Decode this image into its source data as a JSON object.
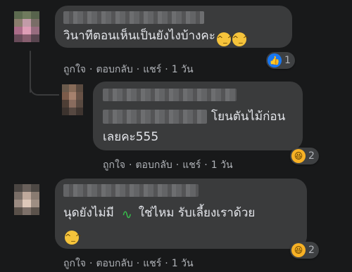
{
  "comments": [
    {
      "text": "วินาทีตอนเห็นเป็นยังไงบ้างคะ",
      "emojis": [
        "😅",
        "😅"
      ],
      "actions": {
        "like": "ถูกใจ",
        "reply": "ตอบกลับ",
        "share": "แชร์",
        "time": "1 วัน"
      },
      "reaction": {
        "icon": "like-icon",
        "count": "1"
      }
    },
    {
      "text_line1": "โยนตันไม้ก่อน",
      "text_line2": "เลยคะ555",
      "actions": {
        "like": "ถูกใจ",
        "reply": "ตอบกลับ",
        "share": "แชร์",
        "time": "1 วัน"
      },
      "reaction": {
        "icon": "haha-icon",
        "count": "2"
      }
    },
    {
      "text_part1": "นุดยังไม่มี",
      "text_part2": "ใช่ไหม รับเลี้ยงเราด้วย",
      "emojis": [
        "🐍",
        "😅"
      ],
      "actions": {
        "like": "ถูกใจ",
        "reply": "ตอบกลับ",
        "share": "แชร์",
        "time": "1 วัน"
      },
      "reaction": {
        "icon": "haha-icon",
        "count": "2"
      }
    }
  ],
  "separator": "·",
  "colors": {
    "background": "#18191a",
    "bubble": "#3a3b3c",
    "text": "#e4e6eb",
    "secondary_text": "#b0b3b8",
    "like_blue": "#1877f2",
    "haha_yellow": "#f7b125"
  }
}
